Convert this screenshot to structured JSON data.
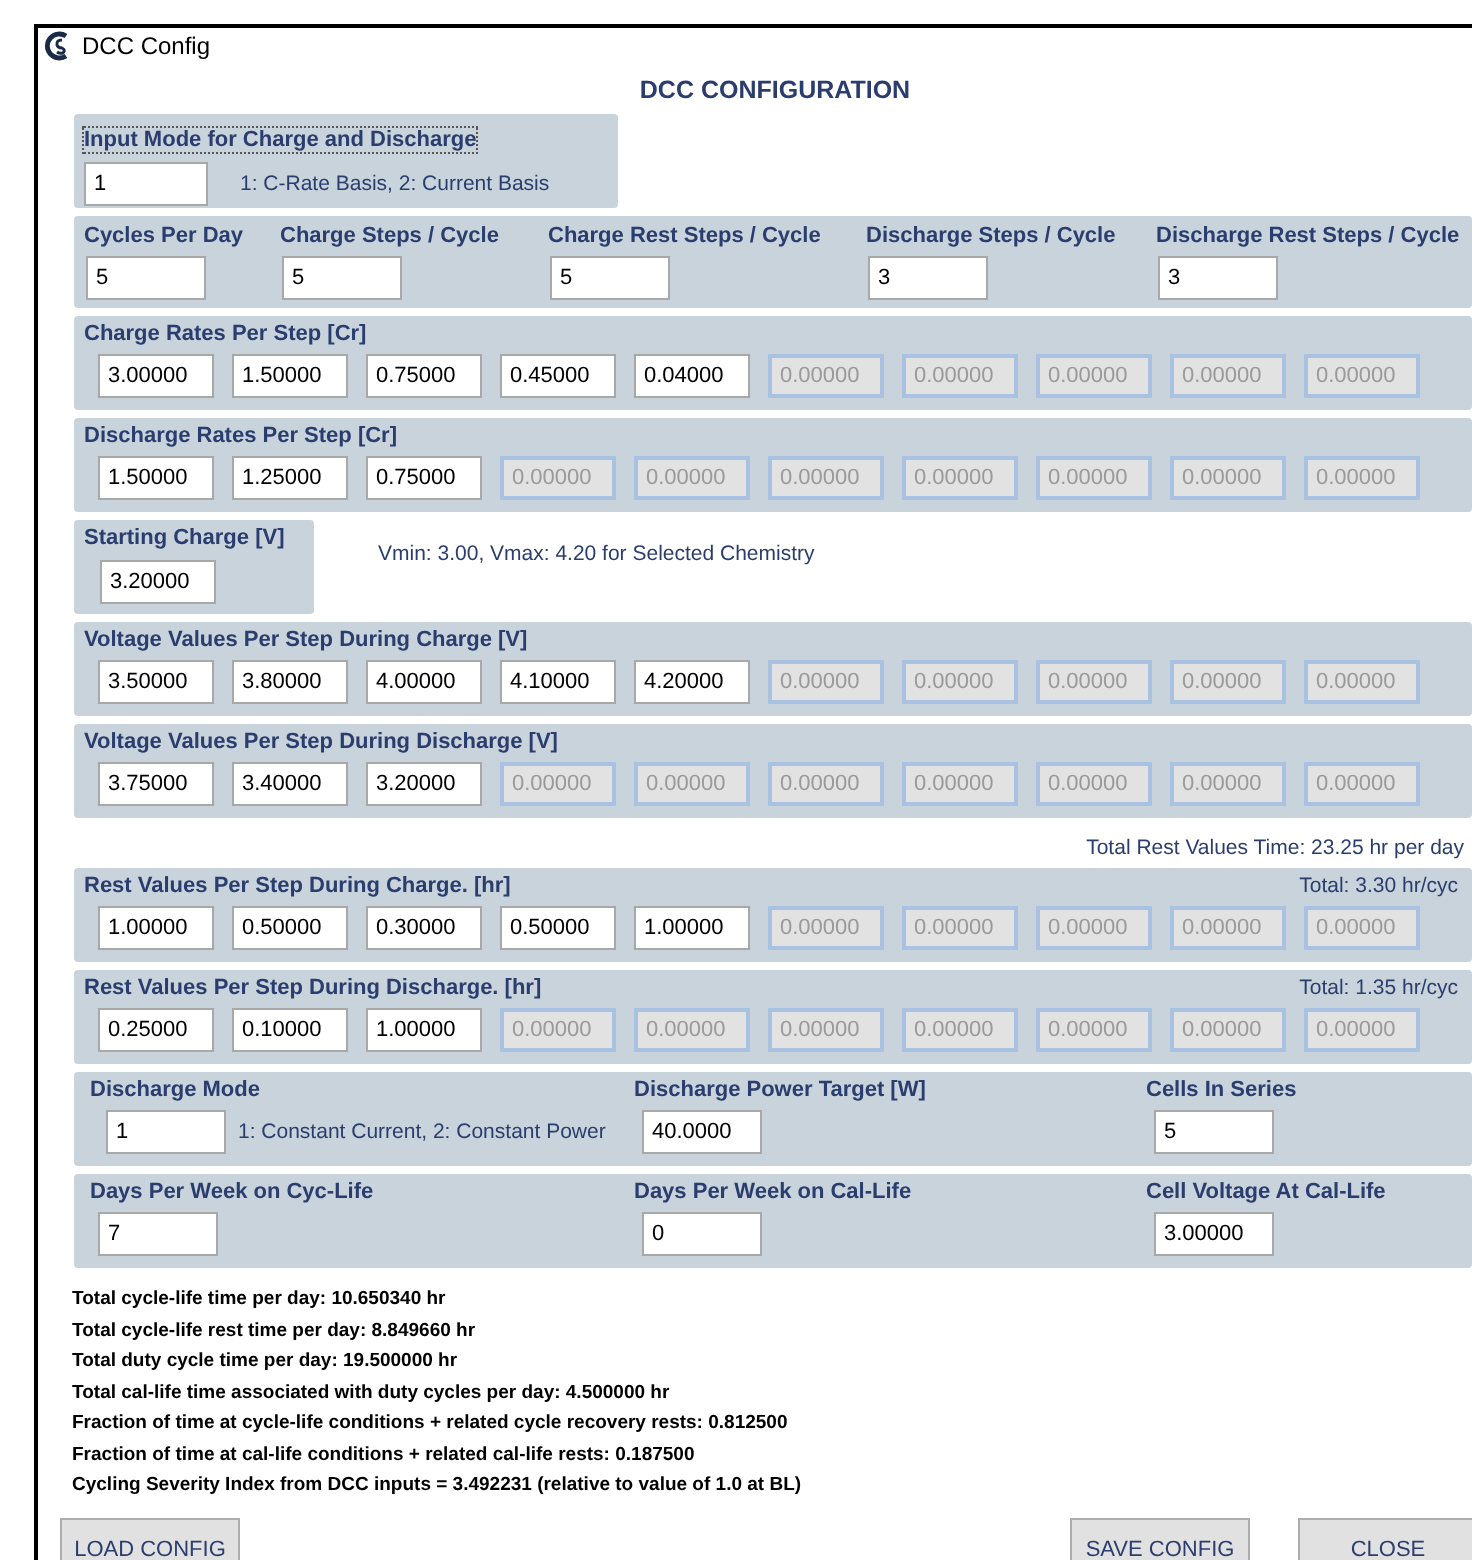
{
  "window": {
    "title": "DCC Config"
  },
  "heading": "DCC CONFIGURATION",
  "input_mode": {
    "label": "Input Mode for Charge and Discharge",
    "value": "1",
    "hint": "1: C-Rate Basis, 2: Current Basis"
  },
  "counts": [
    {
      "label": "Cycles Per Day",
      "value": "5"
    },
    {
      "label": "Charge Steps / Cycle",
      "value": "5"
    },
    {
      "label": "Charge Rest Steps / Cycle",
      "value": "5"
    },
    {
      "label": "Discharge Steps / Cycle",
      "value": "3"
    },
    {
      "label": "Discharge Rest Steps / Cycle",
      "value": "3"
    }
  ],
  "charge_rates": {
    "title": "Charge Rates Per Step [Cr]",
    "fields": [
      {
        "value": "3.00000",
        "disabled": false
      },
      {
        "value": "1.50000",
        "disabled": false
      },
      {
        "value": "0.75000",
        "disabled": false
      },
      {
        "value": "0.45000",
        "disabled": false
      },
      {
        "value": "0.04000",
        "disabled": false
      },
      {
        "value": "0.00000",
        "disabled": true
      },
      {
        "value": "0.00000",
        "disabled": true
      },
      {
        "value": "0.00000",
        "disabled": true
      },
      {
        "value": "0.00000",
        "disabled": true
      },
      {
        "value": "0.00000",
        "disabled": true
      }
    ]
  },
  "discharge_rates": {
    "title": "Discharge Rates Per Step [Cr]",
    "fields": [
      {
        "value": "1.50000",
        "disabled": false
      },
      {
        "value": "1.25000",
        "disabled": false
      },
      {
        "value": "0.75000",
        "disabled": false
      },
      {
        "value": "0.00000",
        "disabled": true
      },
      {
        "value": "0.00000",
        "disabled": true
      },
      {
        "value": "0.00000",
        "disabled": true
      },
      {
        "value": "0.00000",
        "disabled": true
      },
      {
        "value": "0.00000",
        "disabled": true
      },
      {
        "value": "0.00000",
        "disabled": true
      },
      {
        "value": "0.00000",
        "disabled": true
      }
    ]
  },
  "starting_charge": {
    "label": "Starting Charge [V]",
    "value": "3.20000",
    "note": "Vmin: 3.00, Vmax: 4.20 for Selected Chemistry"
  },
  "voltage_charge": {
    "title": "Voltage Values Per Step During Charge [V]",
    "fields": [
      {
        "value": "3.50000",
        "disabled": false
      },
      {
        "value": "3.80000",
        "disabled": false
      },
      {
        "value": "4.00000",
        "disabled": false
      },
      {
        "value": "4.10000",
        "disabled": false
      },
      {
        "value": "4.20000",
        "disabled": false
      },
      {
        "value": "0.00000",
        "disabled": true
      },
      {
        "value": "0.00000",
        "disabled": true
      },
      {
        "value": "0.00000",
        "disabled": true
      },
      {
        "value": "0.00000",
        "disabled": true
      },
      {
        "value": "0.00000",
        "disabled": true
      }
    ]
  },
  "voltage_discharge": {
    "title": "Voltage Values Per Step During Discharge [V]",
    "fields": [
      {
        "value": "3.75000",
        "disabled": false
      },
      {
        "value": "3.40000",
        "disabled": false
      },
      {
        "value": "3.20000",
        "disabled": false
      },
      {
        "value": "0.00000",
        "disabled": true
      },
      {
        "value": "0.00000",
        "disabled": true
      },
      {
        "value": "0.00000",
        "disabled": true
      },
      {
        "value": "0.00000",
        "disabled": true
      },
      {
        "value": "0.00000",
        "disabled": true
      },
      {
        "value": "0.00000",
        "disabled": true
      },
      {
        "value": "0.00000",
        "disabled": true
      }
    ]
  },
  "total_rest": "Total Rest Values Time: 23.25 hr per day",
  "rest_charge": {
    "title": "Rest Values Per Step During Charge. [hr]",
    "total": "Total: 3.30 hr/cyc",
    "fields": [
      {
        "value": "1.00000",
        "disabled": false
      },
      {
        "value": "0.50000",
        "disabled": false
      },
      {
        "value": "0.30000",
        "disabled": false
      },
      {
        "value": "0.50000",
        "disabled": false
      },
      {
        "value": "1.00000",
        "disabled": false
      },
      {
        "value": "0.00000",
        "disabled": true
      },
      {
        "value": "0.00000",
        "disabled": true
      },
      {
        "value": "0.00000",
        "disabled": true
      },
      {
        "value": "0.00000",
        "disabled": true
      },
      {
        "value": "0.00000",
        "disabled": true
      }
    ]
  },
  "rest_discharge": {
    "title": "Rest Values Per Step During Discharge. [hr]",
    "total": "Total: 1.35 hr/cyc",
    "fields": [
      {
        "value": "0.25000",
        "disabled": false
      },
      {
        "value": "0.10000",
        "disabled": false
      },
      {
        "value": "1.00000",
        "disabled": false
      },
      {
        "value": "0.00000",
        "disabled": true
      },
      {
        "value": "0.00000",
        "disabled": true
      },
      {
        "value": "0.00000",
        "disabled": true
      },
      {
        "value": "0.00000",
        "disabled": true
      },
      {
        "value": "0.00000",
        "disabled": true
      },
      {
        "value": "0.00000",
        "disabled": true
      },
      {
        "value": "0.00000",
        "disabled": true
      }
    ]
  },
  "discharge_mode": {
    "label": "Discharge Mode",
    "value": "1",
    "hint": "1: Constant Current, 2: Constant Power"
  },
  "power_target": {
    "label": "Discharge Power Target [W]",
    "value": "40.0000"
  },
  "cells_in_series": {
    "label": "Cells In Series",
    "value": "5"
  },
  "days_cyc": {
    "label": "Days Per Week on Cyc-Life",
    "value": "7"
  },
  "days_cal": {
    "label": "Days Per Week on Cal-Life",
    "value": "0"
  },
  "cal_voltage": {
    "label": "Cell Voltage At Cal-Life",
    "value": "3.00000"
  },
  "summary": [
    "Total cycle-life time per day: 10.650340 hr",
    "Total cycle-life rest time per day: 8.849660 hr",
    "Total duty cycle time per day: 19.500000 hr",
    "Total cal-life time associated with duty cycles per day: 4.500000 hr",
    "Fraction of time at cycle-life conditions + related cycle recovery rests: 0.812500",
    "Fraction of time at cal-life conditions + related cal-life rests: 0.187500",
    "Cycling Severity Index from DCC inputs = 3.492231 (relative to value of 1.0 at BL)"
  ],
  "buttons": {
    "load": "LOAD CONFIG",
    "save": "SAVE CONFIG",
    "close": "CLOSE"
  }
}
